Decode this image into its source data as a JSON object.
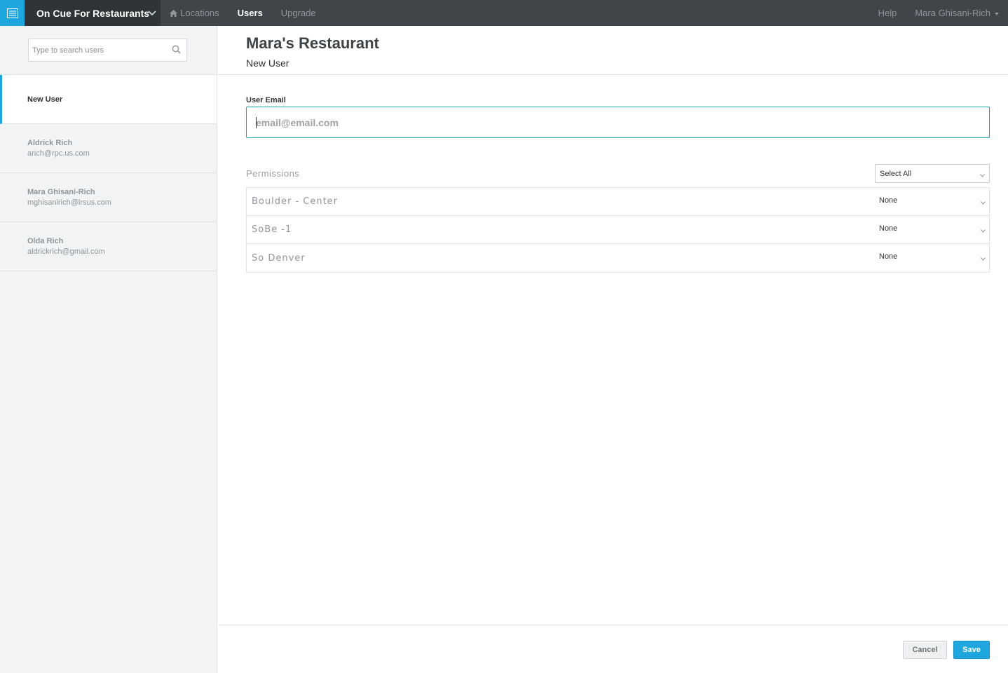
{
  "topbar": {
    "app_name": "On Cue For Restaurants",
    "nav": [
      {
        "label": "Locations",
        "active": false
      },
      {
        "label": "Users",
        "active": true
      },
      {
        "label": "Upgrade",
        "active": false
      }
    ],
    "help": "Help",
    "account": "Mara Ghisani-Rich",
    "accent": "#1ea6de"
  },
  "sidebar": {
    "search_placeholder": "Type to search users",
    "users": [
      {
        "name": "New User",
        "email": "",
        "active": true
      },
      {
        "name": "Aldrick Rich",
        "email": "arich@rpc.us.com",
        "active": false
      },
      {
        "name": "Mara Ghisani-Rich",
        "email": "mghisanirich@lrsus.com",
        "active": false
      },
      {
        "name": "Olda Rich",
        "email": "aldrickrich@gmail.com",
        "active": false
      }
    ]
  },
  "main": {
    "title": "Mara's Restaurant",
    "subtitle": "New User",
    "email_label": "User Email",
    "email_placeholder": "email@email.com",
    "email_value": "",
    "permissions_label": "Permissions",
    "select_all": "Select All",
    "permissions": [
      {
        "location": "Boulder - Center",
        "level": "None"
      },
      {
        "location": "SoBe -1",
        "level": "None"
      },
      {
        "location": "So Denver",
        "level": "None"
      }
    ],
    "cancel": "Cancel",
    "save": "Save"
  }
}
